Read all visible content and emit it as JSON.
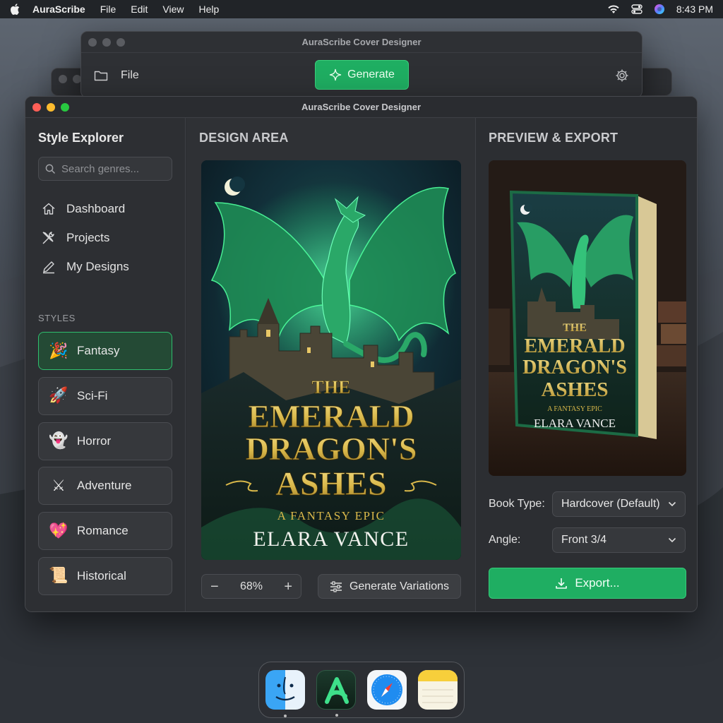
{
  "menubar": {
    "app_name": "AuraScribe",
    "items": [
      "File",
      "Edit",
      "View",
      "Help"
    ],
    "time": "8:43 PM"
  },
  "back_window": {
    "title": "AuraScribe Cover Designer",
    "file_label": "File",
    "generate_label": "Generate"
  },
  "main_window": {
    "title": "AuraScribe Cover Designer"
  },
  "sidebar": {
    "title": "Style Explorer",
    "search_placeholder": "Search genres...",
    "nav": [
      {
        "label": "Dashboard",
        "icon": "home-icon"
      },
      {
        "label": "Projects",
        "icon": "tools-icon"
      },
      {
        "label": "My Designs",
        "icon": "pencil-icon"
      }
    ],
    "styles_label": "STYLES",
    "styles": [
      {
        "label": "Fantasy",
        "emoji": "🎉",
        "active": true
      },
      {
        "label": "Sci-Fi",
        "emoji": "🚀"
      },
      {
        "label": "Horror",
        "emoji": "👻"
      },
      {
        "label": "Adventure",
        "emoji": "⚔"
      },
      {
        "label": "Romance",
        "emoji": "💖"
      },
      {
        "label": "Historical",
        "emoji": "📜"
      }
    ]
  },
  "design": {
    "title": "DESIGN AREA",
    "cover": {
      "line1": "THE",
      "line2": "EMERALD",
      "line3": "DRAGON'S",
      "line4": "ASHES",
      "subtitle": "A FANTASY EPIC",
      "author": "ELARA VANCE"
    },
    "zoom": "68%",
    "variations_label": "Generate Variations"
  },
  "preview": {
    "title": "PREVIEW & EXPORT",
    "book_type_label": "Book Type:",
    "book_type_value": "Hardcover (Default)",
    "angle_label": "Angle:",
    "angle_value": "Front 3/4",
    "export_label": "Export..."
  },
  "dock": {
    "apps": [
      "finder-icon",
      "aurascribe-icon",
      "safari-icon",
      "notes-icon"
    ]
  },
  "colors": {
    "accent_green": "#1fae62",
    "active_style_border": "#2fbf6e",
    "cover_gold": "#d9b84a"
  }
}
